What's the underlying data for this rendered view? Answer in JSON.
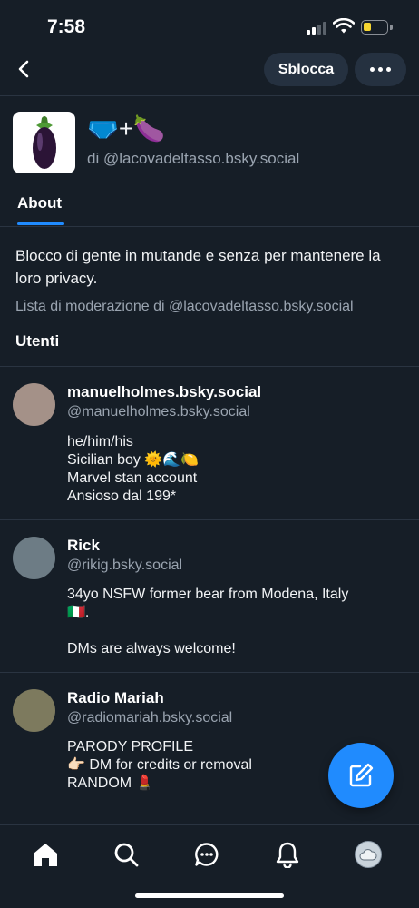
{
  "status_bar": {
    "time": "7:58"
  },
  "header": {
    "back_icon": "chevron-left-icon",
    "unblock_label": "Sblocca",
    "more_icon": "ellipsis-icon"
  },
  "list": {
    "avatar_icon": "eggplant-emoji",
    "title": "🩲+🍆",
    "by": "di @lacovadeltasso.bsky.social"
  },
  "tabs": [
    {
      "label": "About",
      "active": true
    }
  ],
  "about": {
    "description": "Blocco di gente in mutande e senza per mantenere la loro privacy.",
    "moderation_list": "Lista di moderazione di @lacovadeltasso.bsky.social",
    "users_heading": "Utenti"
  },
  "users": [
    {
      "name": "manuelholmes.bsky.social",
      "handle": "@manuelholmes.bsky.social",
      "bio": "he/him/his\nSicilian boy 🌞🌊🍋\nMarvel stan account\nAnsioso dal 199*",
      "avatar_color": "#a49188"
    },
    {
      "name": "Rick",
      "handle": "@rikig.bsky.social",
      "bio": "34yo NSFW former bear from Modena, Italy\n🇮🇹.\n\nDMs are always welcome!",
      "avatar_color": "#6d7c85"
    },
    {
      "name": "Radio Mariah",
      "handle": "@radiomariah.bsky.social",
      "bio": "PARODY PROFILE\n👉🏻 DM for credits or removal\nRANDOM 💄",
      "avatar_color": "#7d7a5e"
    }
  ],
  "fab": {
    "icon": "compose-icon"
  },
  "bottom_nav": [
    {
      "icon": "home-icon",
      "active": true
    },
    {
      "icon": "search-icon"
    },
    {
      "icon": "chat-icon"
    },
    {
      "icon": "bell-icon"
    },
    {
      "icon": "profile-avatar"
    }
  ],
  "colors": {
    "background": "#161e27",
    "accent": "#208bfe",
    "muted_text": "#9aa4b0",
    "button_bg": "#253140"
  }
}
